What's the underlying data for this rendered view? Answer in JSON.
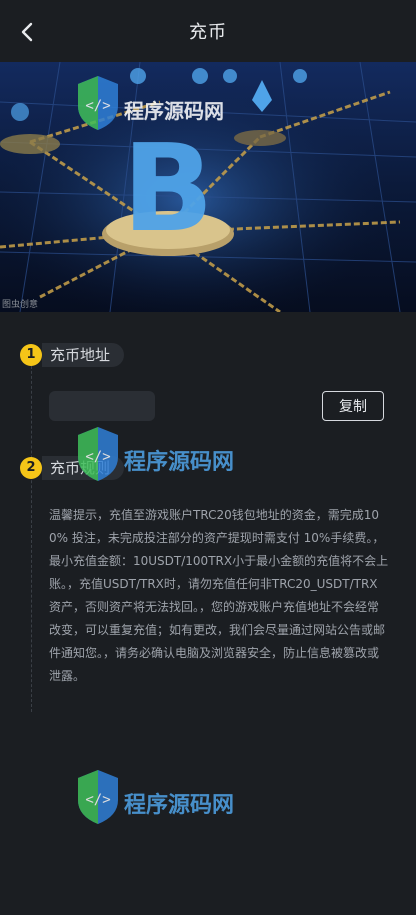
{
  "header": {
    "title": "充币",
    "back_icon": "chevron-left-icon"
  },
  "banner": {
    "caption": "图虫创意",
    "alt_theme": "bitcoin-blockchain-network",
    "colors": {
      "bg": "#0b1a3a",
      "coin": "#4fa3e8",
      "chain": "#c9a24a"
    }
  },
  "steps": [
    {
      "number": "1",
      "label": "充币地址"
    },
    {
      "number": "2",
      "label": "充币规则"
    }
  ],
  "address": {
    "value": "",
    "copy_label": "复制"
  },
  "notice": {
    "text": "温馨提示，充值至游戏账户TRC20钱包地址的资金，需完成100% 投注，未完成投注部分的资产提现时需支付 10%手续费。，最小充值金额：10USDT/100TRX小于最小金额的充值将不会上账。，充值USDT/TRX时，请勿充值任何非TRC20_USDT/TRX资产，否则资产将无法找回。，您的游戏账户充值地址不会经常改变，可以重复充值；如有更改，我们会尽量通过网站公告或邮件通知您。，请务必确认电脑及浏览器安全，防止信息被篡改或泄露。"
  },
  "watermark": {
    "text": "程序源码网",
    "icon": "code-shield-logo-icon",
    "colors": {
      "green": "#3fbf5a",
      "blue": "#2f7fd6"
    }
  },
  "colors": {
    "background": "#1b1e22",
    "accent": "#f5c518",
    "panel": "#2a2e34"
  }
}
